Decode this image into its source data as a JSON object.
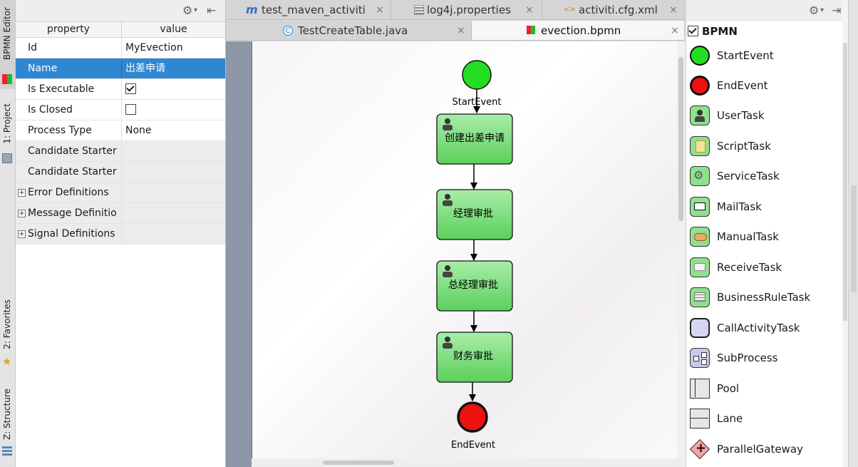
{
  "left_strip": {
    "tabs": [
      {
        "label": "BPMN Editor"
      },
      {
        "label": "1: Project"
      },
      {
        "label": "2: Favorites"
      },
      {
        "label": "Z: Structure"
      }
    ]
  },
  "properties": {
    "header": {
      "property": "property",
      "value": "value"
    },
    "rows": [
      {
        "key": "Id",
        "value": "MyEvection"
      },
      {
        "key": "Name",
        "value": "出差申请"
      },
      {
        "key": "Is Executable",
        "value": ""
      },
      {
        "key": "Is Closed",
        "value": ""
      },
      {
        "key": "Process Type",
        "value": "None"
      },
      {
        "key": "Candidate Starter",
        "value": ""
      },
      {
        "key": "Candidate Starter",
        "value": ""
      },
      {
        "key": "Error Definitions",
        "value": ""
      },
      {
        "key": "Message Definitio",
        "value": ""
      },
      {
        "key": "Signal Definitions",
        "value": ""
      }
    ],
    "is_executable_checked": true,
    "is_closed_checked": false
  },
  "tabs": {
    "row1": [
      {
        "label": "test_maven_activiti"
      },
      {
        "label": "log4j.properties"
      },
      {
        "label": "activiti.cfg.xml"
      }
    ],
    "row2": [
      {
        "label": "TestCreateTable.java"
      },
      {
        "label": "evection.bpmn"
      }
    ],
    "close_glyph": "×"
  },
  "diagram": {
    "start_event": {
      "label": "StartEvent"
    },
    "end_event": {
      "label": "EndEvent"
    },
    "tasks": [
      {
        "label": "创建出差申请"
      },
      {
        "label": "经理审批"
      },
      {
        "label": "总经理审批"
      },
      {
        "label": "财务审批"
      }
    ]
  },
  "palette": {
    "title": "BPMN",
    "items": [
      {
        "label": "StartEvent",
        "icon": "start-event-icon"
      },
      {
        "label": "EndEvent",
        "icon": "end-event-icon"
      },
      {
        "label": "UserTask",
        "icon": "user-task-icon"
      },
      {
        "label": "ScriptTask",
        "icon": "script-task-icon"
      },
      {
        "label": "ServiceTask",
        "icon": "service-task-icon"
      },
      {
        "label": "MailTask",
        "icon": "mail-task-icon"
      },
      {
        "label": "ManualTask",
        "icon": "manual-task-icon"
      },
      {
        "label": "ReceiveTask",
        "icon": "receive-task-icon"
      },
      {
        "label": "BusinessRuleTask",
        "icon": "business-rule-task-icon"
      },
      {
        "label": "CallActivityTask",
        "icon": "call-activity-task-icon"
      },
      {
        "label": "SubProcess",
        "icon": "subprocess-icon"
      },
      {
        "label": "Pool",
        "icon": "pool-icon"
      },
      {
        "label": "Lane",
        "icon": "lane-icon"
      },
      {
        "label": "ParallelGateway",
        "icon": "parallel-gateway-icon"
      }
    ]
  },
  "colors": {
    "selection": "#2f86d1",
    "start_event": "#22dd22",
    "end_event": "#ee1111",
    "task_fill": "#7fd97f"
  }
}
